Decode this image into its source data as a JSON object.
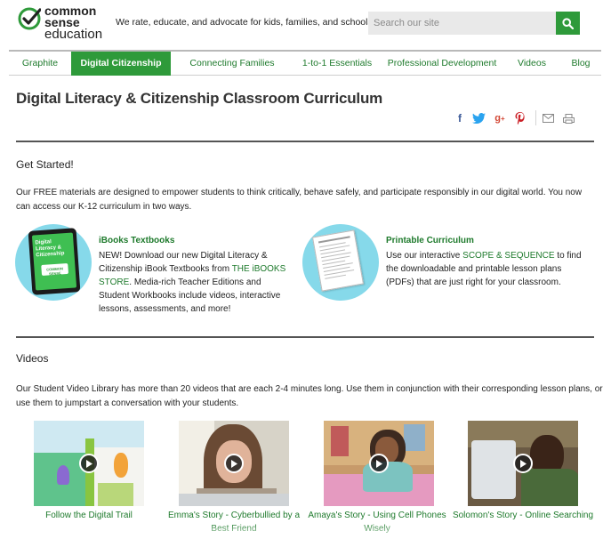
{
  "header": {
    "logo_lines": [
      "common",
      "sense",
      "education"
    ],
    "tagline": "We rate, educate, and advocate for kids, families, and schools",
    "search_placeholder": "Search our site",
    "brand_color": "#2e9a3a"
  },
  "nav": {
    "items": [
      {
        "label": "Graphite",
        "active": false
      },
      {
        "label": "Digital Citizenship",
        "active": true
      },
      {
        "label": "Connecting Families",
        "active": false
      },
      {
        "label": "1-to-1 Essentials",
        "active": false
      },
      {
        "label": "Professional Development",
        "active": false
      },
      {
        "label": "Videos",
        "active": false
      },
      {
        "label": "Blog",
        "active": false
      }
    ]
  },
  "page": {
    "title": "Digital Literacy & Citizenship Classroom Curriculum",
    "share_icons": [
      "facebook-icon",
      "twitter-icon",
      "google-plus-icon",
      "pinterest-icon",
      "email-icon",
      "print-icon"
    ]
  },
  "get_started": {
    "title": "Get Started!",
    "intro": "Our FREE materials are designed to empower students to think critically, behave safely, and participate responsibly in our digital world. You now can access our K-12 curriculum in two ways.",
    "ibooks": {
      "title": "iBooks Textbooks",
      "text_before": "NEW! Download our new Digital Literacy & Citizenship iBook Textbooks from ",
      "link": "THE iBOOKS STORE",
      "text_after": ". Media-rich Teacher Editions and Student Workbooks include videos, interactive lessons, assessments, and more!",
      "tablet_title": "Digital Literacy & Citizenship",
      "tablet_logo": "COMMON SENSE"
    },
    "printable": {
      "title": "Printable Curriculum",
      "text_before": "Use our interactive ",
      "link": "SCOPE & SEQUENCE",
      "text_after": " to find the downloadable and printable lesson plans (PDFs) that are just right for your classroom."
    }
  },
  "videos": {
    "title": "Videos",
    "intro": "Our Student Video Library has more than 20 videos that are each 2-4 minutes long. Use them in conjunction with their corresponding lesson plans, or use them to jumpstart a conversation with your students.",
    "items": [
      {
        "caption": "Follow the Digital Trail"
      },
      {
        "caption": "Emma's Story - Cyberbullied by a Best Friend"
      },
      {
        "caption": "Amaya's Story - Using Cell Phones Wisely"
      },
      {
        "caption": "Solomon's Story - Online Searching"
      }
    ]
  }
}
